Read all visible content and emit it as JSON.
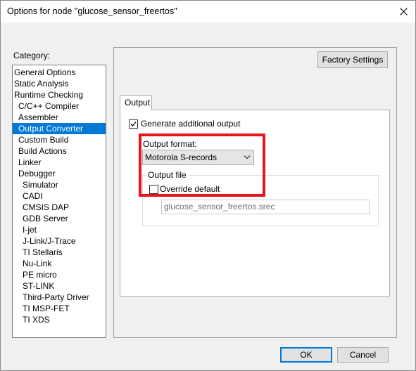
{
  "window": {
    "title": "Options for node \"glucose_sensor_freertos\"",
    "close_icon": "close-icon"
  },
  "category": {
    "label": "Category:",
    "items": [
      {
        "label": "General Options",
        "level": 0
      },
      {
        "label": "Static Analysis",
        "level": 0
      },
      {
        "label": "Runtime Checking",
        "level": 0
      },
      {
        "label": "C/C++ Compiler",
        "level": 1
      },
      {
        "label": "Assembler",
        "level": 1
      },
      {
        "label": "Output Converter",
        "level": 1,
        "selected": true
      },
      {
        "label": "Custom Build",
        "level": 1
      },
      {
        "label": "Build Actions",
        "level": 1
      },
      {
        "label": "Linker",
        "level": 1
      },
      {
        "label": "Debugger",
        "level": 1
      },
      {
        "label": "Simulator",
        "level": 2
      },
      {
        "label": "CADI",
        "level": 2
      },
      {
        "label": "CMSIS DAP",
        "level": 2
      },
      {
        "label": "GDB Server",
        "level": 2
      },
      {
        "label": "I-jet",
        "level": 2
      },
      {
        "label": "J-Link/J-Trace",
        "level": 2
      },
      {
        "label": "TI Stellaris",
        "level": 2
      },
      {
        "label": "Nu-Link",
        "level": 2
      },
      {
        "label": "PE micro",
        "level": 2
      },
      {
        "label": "ST-LINK",
        "level": 2
      },
      {
        "label": "Third-Party Driver",
        "level": 2
      },
      {
        "label": "TI MSP-FET",
        "level": 2
      },
      {
        "label": "TI XDS",
        "level": 2
      }
    ]
  },
  "panel": {
    "factory_settings_label": "Factory Settings",
    "tabs": [
      {
        "label": "Output",
        "active": true
      }
    ],
    "generate_output": {
      "label": "Generate additional output",
      "checked": true
    },
    "output_format": {
      "label": "Output format:",
      "value": "Motorola S-records"
    },
    "output_file": {
      "legend": "Output file",
      "override": {
        "label": "Override default",
        "checked": false
      },
      "value": "glucose_sensor_freertos.srec"
    }
  },
  "footer": {
    "ok_label": "OK",
    "cancel_label": "Cancel"
  },
  "colors": {
    "selection": "#0078d7",
    "highlight": "#e8141d",
    "dialog_bg": "#f0f0f0"
  }
}
